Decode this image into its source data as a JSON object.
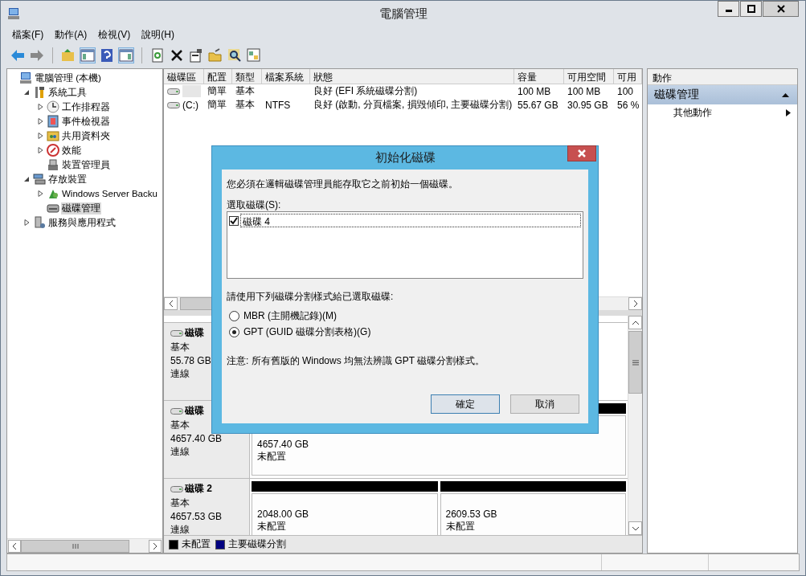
{
  "window": {
    "title": "電腦管理"
  },
  "menu": [
    "檔案(F)",
    "動作(A)",
    "檢視(V)",
    "說明(H)"
  ],
  "tree": {
    "items": [
      {
        "label": "電腦管理 (本機)",
        "kind": "root",
        "selected": false,
        "children": [
          {
            "label": "系統工具",
            "kind": "node",
            "expanded": true,
            "selected": false,
            "children": [
              {
                "label": "工作排程器",
                "kind": "node",
                "expanded": false,
                "selected": false
              },
              {
                "label": "事件檢視器",
                "kind": "node",
                "expanded": false,
                "selected": false
              },
              {
                "label": "共用資料夾",
                "kind": "node",
                "expanded": false,
                "selected": false
              },
              {
                "label": "效能",
                "kind": "node",
                "expanded": false,
                "selected": false
              },
              {
                "label": "裝置管理員",
                "kind": "leaf",
                "selected": false
              }
            ]
          },
          {
            "label": "存放裝置",
            "kind": "node",
            "expanded": true,
            "selected": false,
            "children": [
              {
                "label": "Windows Server Backu",
                "kind": "node",
                "expanded": false,
                "selected": false
              },
              {
                "label": "磁碟管理",
                "kind": "leaf",
                "selected": true
              }
            ]
          },
          {
            "label": "服務與應用程式",
            "kind": "node",
            "expanded": false,
            "selected": false
          }
        ]
      }
    ]
  },
  "volumes": {
    "columns": [
      "磁碟區",
      "配置",
      "類型",
      "檔案系統",
      "狀態",
      "容量",
      "可用空間",
      "可用"
    ],
    "rows": [
      {
        "cells": [
          null,
          "簡單",
          "基本",
          null,
          "良好 (EFI 系統磁碟分割)",
          "100 MB",
          "100 MB",
          "100"
        ]
      },
      {
        "cells": [
          "(C:)",
          "簡單",
          "基本",
          "NTFS",
          "良好 (啟動, 分頁檔案, 損毀傾印, 主要磁碟分割)",
          "55.67 GB",
          "30.95 GB",
          "56 %"
        ]
      }
    ]
  },
  "disks": [
    {
      "label": "磁碟",
      "type": "基本",
      "size": "55.78 GB",
      "status": "連線"
    },
    {
      "label": "磁碟",
      "type": "基本",
      "size": "4657.40 GB",
      "status": "連線",
      "partitions": [
        {
          "size": "4657.40 GB",
          "status": "未配置",
          "color": "#000000"
        }
      ]
    },
    {
      "label": "磁碟 2",
      "type": "基本",
      "size": "4657.53 GB",
      "status": "連線",
      "partitions": [
        {
          "size": "2048.00 GB",
          "status": "未配置",
          "color": "#000000"
        },
        {
          "size": "2609.53 GB",
          "status": "未配置",
          "color": "#000000"
        }
      ]
    }
  ],
  "legend": [
    {
      "label": "未配置",
      "color": "#000000"
    },
    {
      "label": "主要磁碟分割",
      "color": "#000080"
    }
  ],
  "actions": {
    "header": "動作",
    "section": "磁碟管理",
    "items": [
      "其他動作"
    ]
  },
  "dialog": {
    "title": "初始化磁碟",
    "message": "您必須在邏輯磁碟管理員能存取它之前初始一個磁碟。",
    "list_label": "選取磁碟(S):",
    "disks": [
      {
        "label": "磁碟 4",
        "checked": true,
        "selected": true
      }
    ],
    "prompt": "請使用下列磁碟分割樣式給已選取磁碟:",
    "options": [
      {
        "label": "MBR (主開機記錄)(M)",
        "selected": false
      },
      {
        "label": "GPT (GUID 磁碟分割表格)(G)",
        "selected": true
      }
    ],
    "note": "注意: 所有舊版的 Windows 均無法辨識 GPT 磁碟分割樣式。",
    "buttons": [
      {
        "label": "確定",
        "default": true
      },
      {
        "label": "取消",
        "default": false
      }
    ]
  }
}
